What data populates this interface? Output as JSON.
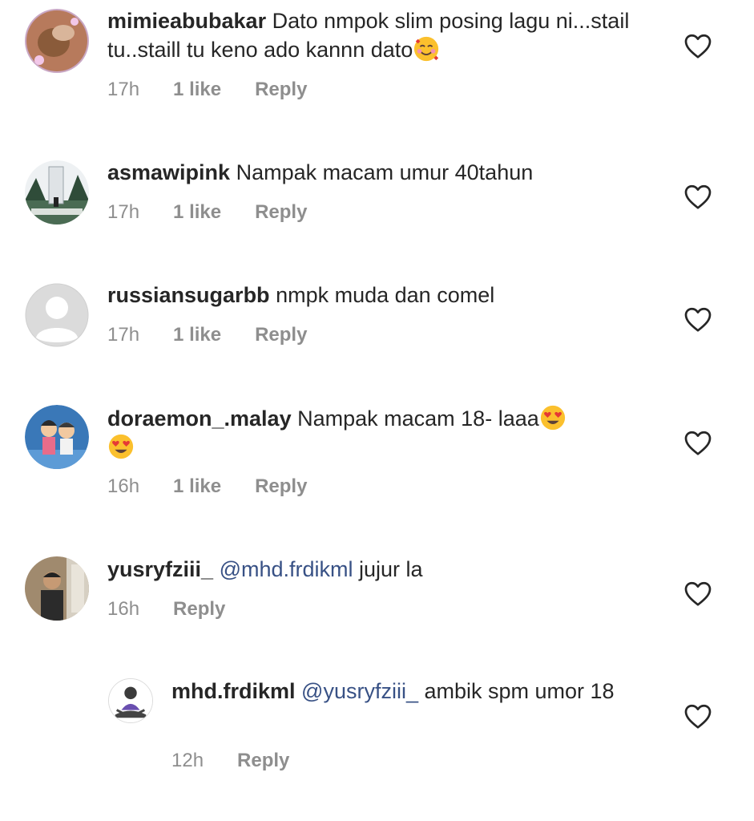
{
  "comments": [
    {
      "username": "mimieabubakar",
      "text": "Dato nmpok slim posing lagu ni...stail tu..staill tu keno ado kannn dato",
      "emoji": "smiling-hearts-emoji",
      "time": "17h",
      "likes": "1 like",
      "reply": "Reply"
    },
    {
      "username": "asmawipink",
      "text": "Nampak macam umur 40tahun",
      "time": "17h",
      "likes": "1 like",
      "reply": "Reply"
    },
    {
      "username": "russiansugarbb",
      "text": "nmpk muda dan comel",
      "time": "17h",
      "likes": "1 like",
      "reply": "Reply"
    },
    {
      "username": "doraemon_.malay",
      "text": "Nampak macam 18- laaa",
      "emoji": "heart-eyes-emoji",
      "time": "16h",
      "likes": "1 like",
      "reply": "Reply"
    },
    {
      "username": "yusryfziii_",
      "mention": "@mhd.frdikml",
      "text": "jujur la",
      "time": "16h",
      "reply": "Reply"
    },
    {
      "username": "mhd.frdikml",
      "mention": "@yusryfziii_",
      "text": "ambik spm umor 18",
      "time": "12h",
      "reply": "Reply"
    }
  ]
}
